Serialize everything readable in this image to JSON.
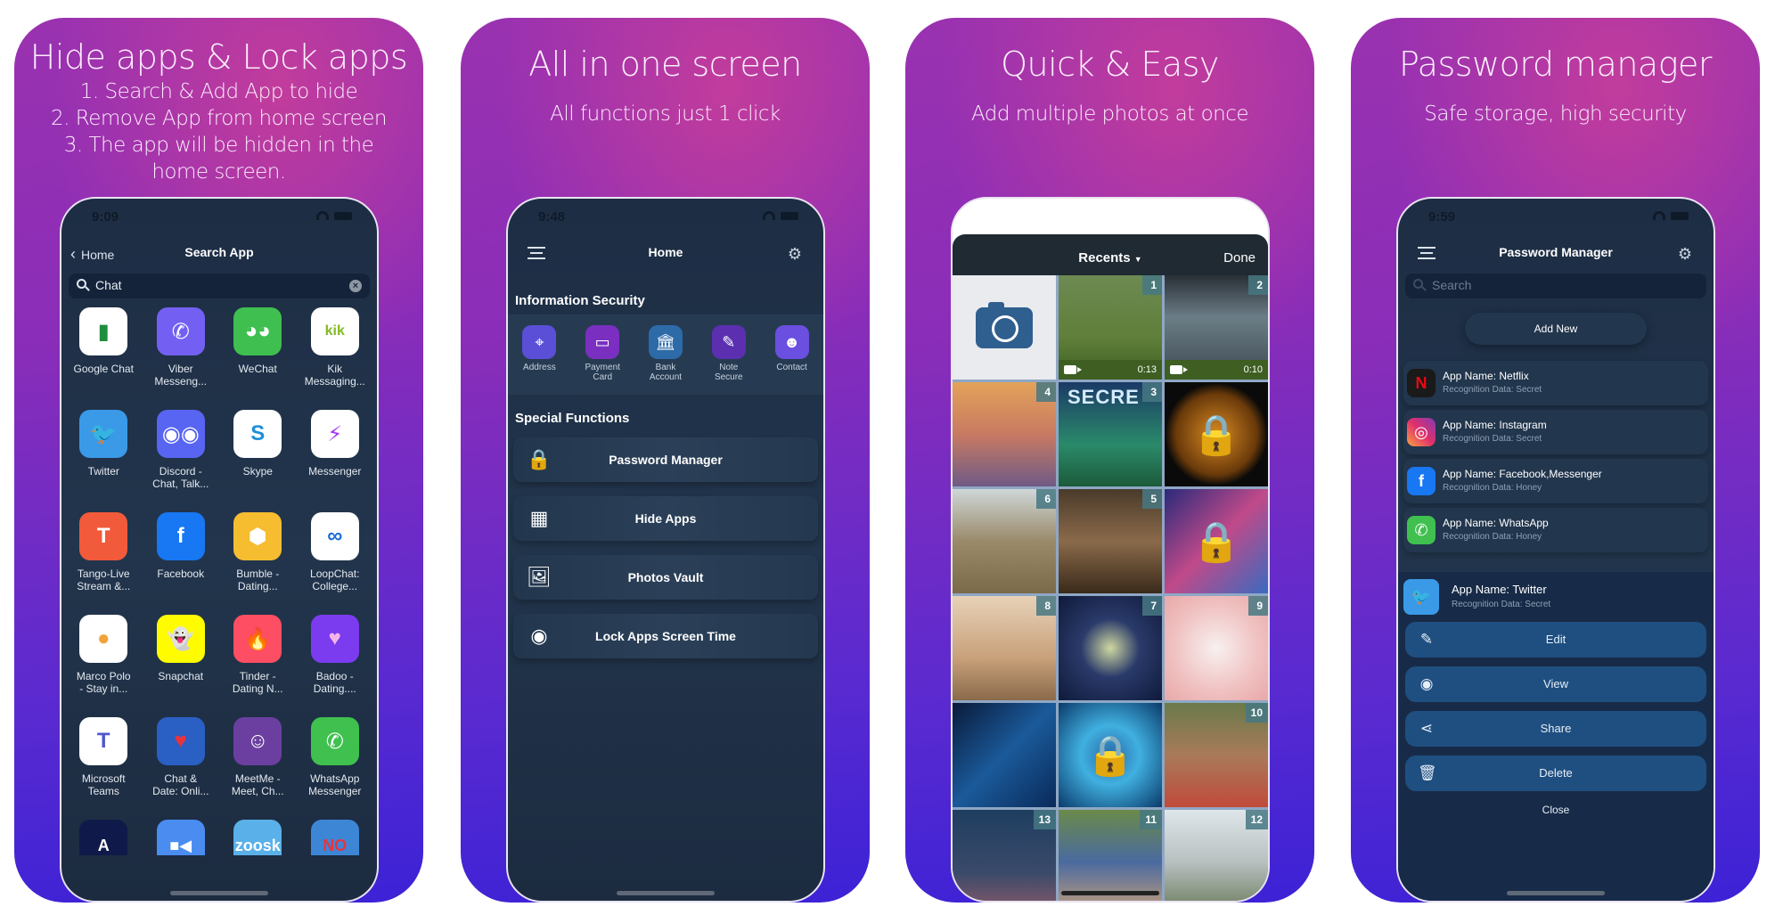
{
  "panels": [
    {
      "headline": "Hide apps & Lock apps",
      "subheadline": "1. Search & Add App to hide\n2. Remove App from home screen\n3. The app will be hidden in the\nhome screen.",
      "status_time": "9:09",
      "nav": {
        "back_label": "Home",
        "title": "Search App"
      },
      "search": {
        "value": "Chat"
      },
      "apps": [
        {
          "name": "Google Chat",
          "icon": "google-chat-icon",
          "glyph": "▮",
          "bg": "#ffffff",
          "fg": "#1e8e3e"
        },
        {
          "name": "Viber\nMesseng...",
          "icon": "viber-icon",
          "glyph": "✆",
          "bg": "#7360f2",
          "fg": "#ffffff"
        },
        {
          "name": "WeChat",
          "icon": "wechat-icon",
          "glyph": "◕◕",
          "bg": "#3fbf4f",
          "fg": "#ffffff"
        },
        {
          "name": "Kik\nMessaging...",
          "icon": "kik-icon",
          "glyph": "kik",
          "bg": "#ffffff",
          "fg": "#82bc23"
        },
        {
          "name": "Twitter",
          "icon": "twitter-icon",
          "glyph": "🐦",
          "bg": "#3b9ae8",
          "fg": "#ffffff"
        },
        {
          "name": "Discord -\nChat, Talk...",
          "icon": "discord-icon",
          "glyph": "◉◉",
          "bg": "#5865f2",
          "fg": "#ffffff"
        },
        {
          "name": "Skype",
          "icon": "skype-icon",
          "glyph": "S",
          "bg": "#ffffff",
          "fg": "#1d8fd8"
        },
        {
          "name": "Messenger",
          "icon": "messenger-icon",
          "glyph": "⚡",
          "bg": "#ffffff",
          "fg": "#a334fa"
        },
        {
          "name": "Tango-Live\nStream &...",
          "icon": "tango-icon",
          "glyph": "T",
          "bg": "#f15a3a",
          "fg": "#ffffff"
        },
        {
          "name": "Facebook",
          "icon": "facebook-icon",
          "glyph": "f",
          "bg": "#1877f2",
          "fg": "#ffffff"
        },
        {
          "name": "Bumble -\nDating...",
          "icon": "bumble-icon",
          "glyph": "⬢",
          "bg": "#f6bd31",
          "fg": "#ffffff"
        },
        {
          "name": "LoopChat:\nCollege...",
          "icon": "loopchat-icon",
          "glyph": "∞",
          "bg": "#ffffff",
          "fg": "#1a6fd6"
        },
        {
          "name": "Marco Polo\n- Stay in...",
          "icon": "marco-polo-icon",
          "glyph": "●",
          "bg": "#ffffff",
          "fg": "#f2a33a"
        },
        {
          "name": "Snapchat",
          "icon": "snapchat-icon",
          "glyph": "👻",
          "bg": "#fffc00",
          "fg": "#ffffff"
        },
        {
          "name": "Tinder -\nDating N...",
          "icon": "tinder-icon",
          "glyph": "🔥",
          "bg": "#fd4e63",
          "fg": "#ffffff"
        },
        {
          "name": "Badoo -\nDating....",
          "icon": "badoo-icon",
          "glyph": "♥",
          "bg": "#7b3cf0",
          "fg": "#f3b3e8"
        },
        {
          "name": "Microsoft\nTeams",
          "icon": "teams-icon",
          "glyph": "T",
          "bg": "#ffffff",
          "fg": "#5059c9"
        },
        {
          "name": "Chat &\nDate: Onli...",
          "icon": "chat-date-icon",
          "glyph": "♥",
          "bg": "#2a5fc4",
          "fg": "#e8333f"
        },
        {
          "name": "MeetMe -\nMeet, Ch...",
          "icon": "meetme-icon",
          "glyph": "☺",
          "bg": "#6b3fa0",
          "fg": "#ffffff"
        },
        {
          "name": "WhatsApp\nMessenger",
          "icon": "whatsapp-icon",
          "glyph": "✆",
          "bg": "#3fc04f",
          "fg": "#ffffff"
        }
      ],
      "partial_apps": [
        {
          "icon": "anonymous-app-icon",
          "glyph": "A",
          "bg": "#0f1a4a",
          "fg": "#ffffff"
        },
        {
          "icon": "zoom-icon",
          "glyph": "■◀",
          "bg": "#4a8cf0",
          "fg": "#ffffff"
        },
        {
          "icon": "zoosk-icon",
          "glyph": "zoosk",
          "bg": "#5ab0e8",
          "fg": "#ffffff"
        },
        {
          "icon": "no-app-icon",
          "glyph": "NO",
          "bg": "#3d86d6",
          "fg": "#e8333f"
        }
      ]
    },
    {
      "headline": "All in one screen",
      "subheadline": "All functions just 1 click",
      "status_time": "9:48",
      "nav": {
        "title": "Home"
      },
      "info_section_title": "Information Security",
      "info_items": [
        {
          "label": "Address",
          "icon": "address-pin-icon",
          "glyph": "⌖",
          "bg": "#5a4fd6"
        },
        {
          "label": "Payment\nCard",
          "icon": "payment-card-icon",
          "glyph": "▭",
          "bg": "#7a2fc0"
        },
        {
          "label": "Bank\nAccount",
          "icon": "bank-icon",
          "glyph": "🏛",
          "bg": "#2d6aa8"
        },
        {
          "label": "Note\nSecure",
          "icon": "note-secure-icon",
          "glyph": "✎",
          "bg": "#5b2fb0"
        },
        {
          "label": "Contact",
          "icon": "contact-icon",
          "glyph": "☻",
          "bg": "#6a4fe0"
        }
      ],
      "special_section_title": "Special Functions",
      "functions": [
        {
          "label": "Password Manager",
          "icon": "password-lock-icon",
          "glyph": "🔒"
        },
        {
          "label": "Hide Apps",
          "icon": "hide-apps-grid-icon",
          "glyph": "▦"
        },
        {
          "label": "Photos Vault",
          "icon": "photos-vault-icon",
          "glyph": "🖼"
        },
        {
          "label": "Lock Apps Screen Time",
          "icon": "eye-icon",
          "glyph": "◉"
        }
      ]
    },
    {
      "headline": "Quick & Easy",
      "subheadline": "Add multiple photos at once",
      "picker": {
        "title": "Recents",
        "done_label": "Done"
      },
      "photos": [
        {
          "type": "camera"
        },
        {
          "badge": "1",
          "video": "0:13",
          "bg": "linear-gradient(180deg,#6d8a52,#5f7f3a 60%,#3e5e22)"
        },
        {
          "badge": "2",
          "video": "0:10",
          "bg": "linear-gradient(180deg,#2a2f36,#6b7d86 40%,#3d4a52)"
        },
        {
          "badge": "4",
          "bg": "linear-gradient(180deg,#e3a25a,#c87a62 50%,#6f5a86)"
        },
        {
          "badge": "3",
          "text": "SECRE",
          "bg": "linear-gradient(180deg,#1b3a66,#2a8a6a 60%,#1c5a3a)"
        },
        {
          "lock": "🔒",
          "bg": "radial-gradient(circle,#d98a22 0%,#6a3a0a 55%,#0a0a0a 70%)"
        },
        {
          "badge": "6",
          "bg": "linear-gradient(180deg,#cfd7d8,#9a8a6a 50%,#7a6a4a)"
        },
        {
          "badge": "5",
          "bg": "linear-gradient(180deg,#4a3a2a,#8a6a4a 50%,#3a2a1a)"
        },
        {
          "lock": "🔒",
          "bg": "linear-gradient(135deg,#2a2a7a,#c04a8a 50%,#3a6ac0)"
        },
        {
          "badge": "8",
          "bg": "linear-gradient(180deg,#e8d2b8,#c8a07a 60%,#8a6a4a)"
        },
        {
          "badge": "7",
          "bg": "radial-gradient(circle at 50% 50%,#cfd8a0 0%,#2a3a6a 40%,#0f1a3a 100%)"
        },
        {
          "badge": "9",
          "bg": "radial-gradient(circle,#f8f0f0 0%,#f0c0c0 60%,#e8a8a8 100%)"
        },
        {
          "lock": "",
          "bg": "linear-gradient(135deg,#0a1a3a,#1a5a9a 50%,#0a2a5a)"
        },
        {
          "lock": "🔒",
          "bg": "radial-gradient(circle,#2a6aa8 0%,#40b0e0 40%,#0a3a6a 100%)"
        },
        {
          "badge": "10",
          "bg": "linear-gradient(180deg,#6a7a4a,#a87a5a 50%,#c04a3a)"
        },
        {
          "badge": "13",
          "bg": "linear-gradient(180deg,#1e3e60,#3a4a6a 60%,#8a5a6a)"
        },
        {
          "badge": "11",
          "bg": "linear-gradient(180deg,#6a8a4a,#4a6aa0 50%,#c8a07a)"
        },
        {
          "badge": "12",
          "bg": "linear-gradient(180deg,#dfe6ea,#b8c0c0 50%,#6a7a5a)"
        }
      ]
    },
    {
      "headline": "Password manager",
      "subheadline": "Safe storage, high security",
      "status_time": "9:59",
      "nav": {
        "title": "Password Manager"
      },
      "search": {
        "placeholder": "Search"
      },
      "add_new_label": "Add New",
      "entries": [
        {
          "name": "App Name: Netflix",
          "recognition": "Recognition Data: Secret",
          "icon": "netflix-icon",
          "glyph": "N",
          "bg": "#1a1a1a",
          "fg": "#e50914"
        },
        {
          "name": "App Name: Instagram",
          "recognition": "Recognition Data: Secret",
          "icon": "instagram-icon",
          "glyph": "◎",
          "bg": "linear-gradient(45deg,#f9a341,#e1306c 50%,#833ab4)",
          "fg": "#ffffff"
        },
        {
          "name": "App Name: Facebook,Messenger",
          "recognition": "Recognition Data: Honey",
          "icon": "facebook-icon",
          "glyph": "f",
          "bg": "#1877f2",
          "fg": "#ffffff"
        },
        {
          "name": "App Name: WhatsApp",
          "recognition": "Recognition Data: Honey",
          "icon": "whatsapp-icon",
          "glyph": "✆",
          "bg": "#3fc04f",
          "fg": "#ffffff"
        }
      ],
      "selected_entry": {
        "name": "App Name: Twitter",
        "recognition": "Recognition Data: Secret",
        "icon": "twitter-icon",
        "glyph": "🐦",
        "bg": "#3b9ae8",
        "fg": "#ffffff"
      },
      "actions": [
        {
          "label": "Edit",
          "icon": "pencil-icon",
          "glyph": "✎"
        },
        {
          "label": "View",
          "icon": "eye-icon",
          "glyph": "◉"
        },
        {
          "label": "Share",
          "icon": "share-icon",
          "glyph": "⋖"
        },
        {
          "label": "Delete",
          "icon": "trash-icon",
          "glyph": "🗑"
        }
      ],
      "close_label": "Close"
    }
  ]
}
